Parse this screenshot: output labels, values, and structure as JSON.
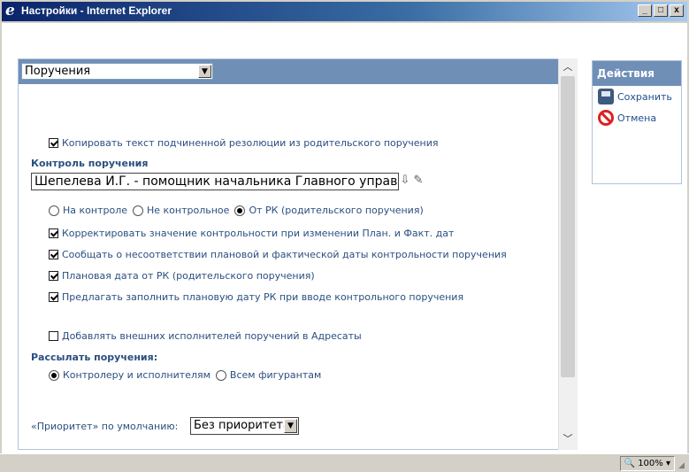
{
  "window": {
    "title": "Настройки - Internet Explorer",
    "ie_glyph": "e",
    "min_label": "_",
    "max_label": "□",
    "close_label": "x"
  },
  "form": {
    "section_select": {
      "value": "Поручения",
      "arrow": "▼"
    },
    "copy_text_label": "Копировать текст подчиненной резолюции из родительского поручения",
    "control_title": "Контроль поручения",
    "controller_value": "Шепелева И.Г. - помощник начальника Главного управле",
    "control_radios": [
      {
        "label": "На контроле",
        "checked": false
      },
      {
        "label": "Не контрольное",
        "checked": false
      },
      {
        "label": "От РК (родительского поручения)",
        "checked": true
      }
    ],
    "checkboxes": [
      {
        "label": "Корректировать значение контрольности при изменении План. и Факт. дат",
        "checked": true
      },
      {
        "label": "Сообщать о несоответствии плановой и фактической даты контрольности поручения",
        "checked": true
      },
      {
        "label": "Плановая дата от РК (родительского поручения)",
        "checked": true
      },
      {
        "label": "Предлагать заполнить плановую дату РК при вводе контрольного поручения",
        "checked": true
      }
    ],
    "add_external_label": "Добавлять внешних исполнителей поручений в Адресаты",
    "send_title": "Рассылать поручения:",
    "send_radios": [
      {
        "label": "Контролеру и исполнителям",
        "checked": true
      },
      {
        "label": "Всем фигурантам",
        "checked": false
      }
    ],
    "priority_label": "«Приоритет» по умолчанию:",
    "priority_select": {
      "value": "Без приоритета",
      "arrow": "▼"
    }
  },
  "actions": {
    "header": "Действия",
    "save_label": "Сохранить",
    "cancel_label": "Отмена"
  },
  "status": {
    "zoom": "100%",
    "zoom_arrow": "▾"
  },
  "icons": {
    "user_picker": "⇩",
    "eraser": "✎",
    "scroll_up": "︿",
    "scroll_down": "﹀"
  }
}
